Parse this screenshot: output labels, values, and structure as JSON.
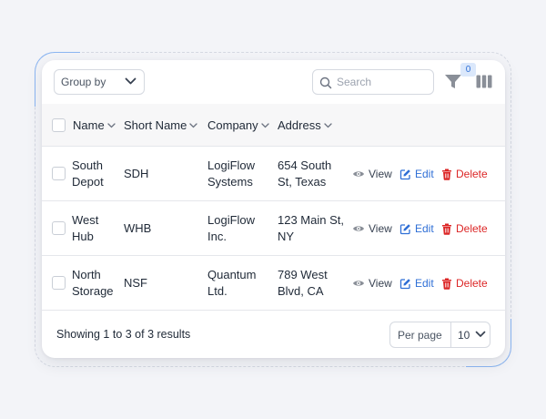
{
  "toolbar": {
    "group_by_label": "Group by",
    "search_placeholder": "Search",
    "filter_count": "0"
  },
  "table": {
    "columns": [
      {
        "label": "Name"
      },
      {
        "label": "Short Name"
      },
      {
        "label": "Company"
      },
      {
        "label": "Address"
      }
    ],
    "rows": [
      {
        "name": [
          "South",
          "Depot"
        ],
        "short_name": "SDH",
        "company": [
          "LogiFlow",
          "Systems"
        ],
        "address": [
          "654 South",
          "St, Texas"
        ]
      },
      {
        "name": [
          "West",
          "Hub"
        ],
        "short_name": "WHB",
        "company": [
          "LogiFlow",
          "Inc."
        ],
        "address": [
          "123 Main St,",
          "NY"
        ]
      },
      {
        "name": [
          "North",
          "Storage"
        ],
        "short_name": "NSF",
        "company": [
          "Quantum",
          "Ltd."
        ],
        "address": [
          "789 West",
          "Blvd, CA"
        ]
      }
    ],
    "actions": {
      "view": "View",
      "edit": "Edit",
      "delete": "Delete"
    }
  },
  "footer": {
    "summary": "Showing 1 to 3 of 3 results",
    "per_page_label": "Per page",
    "per_page_value": "10"
  },
  "colors": {
    "accent_blue": "#2f6fd6",
    "delete_red": "#dc2626",
    "badge_bg": "#dbe8fb",
    "header_bg": "#f7f7f8"
  }
}
